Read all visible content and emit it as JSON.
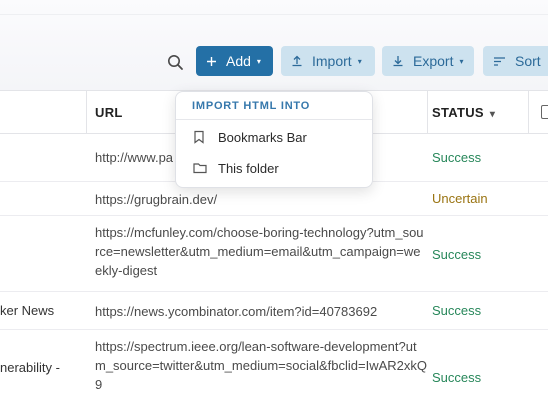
{
  "toolbar": {
    "search_icon": "search-icon",
    "add_label": "Add",
    "import_label": "Import",
    "export_label": "Export",
    "sort_label": "Sort",
    "accent_color": "#2470a6",
    "secondary_button_color": "#cde2ef"
  },
  "table": {
    "columns": [
      {
        "label": "URL"
      },
      {
        "label": "STATUS",
        "sort_caret": "▾"
      }
    ],
    "rows": [
      {
        "title": "",
        "url": "http://www.pa",
        "status": "Success"
      },
      {
        "title": "",
        "url": "https://grugbrain.dev/",
        "status": "Uncertain"
      },
      {
        "title": "",
        "url": "https://mcfunley.com/choose-boring-technology?utm_source=newsletter&utm_medium=email&utm_campaign=weekly-digest",
        "status": "Success"
      },
      {
        "title": "ker News",
        "url": "https://news.ycombinator.com/item?id=40783692",
        "status": "Success"
      },
      {
        "title": "nerability -",
        "url": "https://spectrum.ieee.org/lean-software-development?utm_source=twitter&utm_medium=social&fbclid=IwAR2xkQ9",
        "status": "Success"
      }
    ],
    "status_colors": {
      "Success": "#27875a",
      "Uncertain": "#9a7412"
    }
  },
  "import_menu": {
    "header": "IMPORT HTML INTO",
    "items": [
      {
        "label": "Bookmarks Bar",
        "icon": "bookmark-icon"
      },
      {
        "label": "This folder",
        "icon": "folder-icon"
      }
    ]
  }
}
